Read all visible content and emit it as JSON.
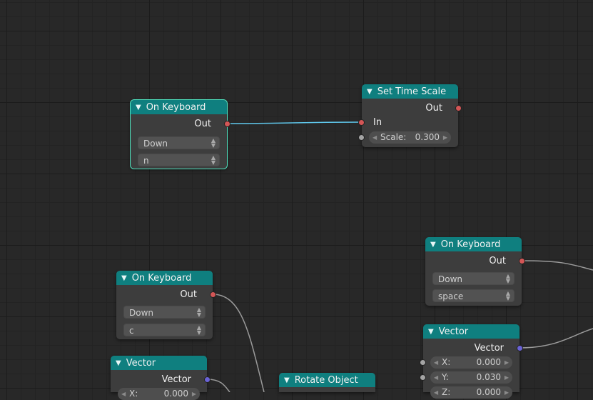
{
  "nodes": {
    "kb1": {
      "title": "On Keyboard",
      "output": "Out",
      "event": "Down",
      "key": "n"
    },
    "timescale": {
      "title": "Set Time Scale",
      "output": "Out",
      "input": "In",
      "scale_label": "Scale:",
      "scale_value": "0.300"
    },
    "kb2": {
      "title": "On Keyboard",
      "output": "Out",
      "event": "Down",
      "key": "space"
    },
    "kb3": {
      "title": "On Keyboard",
      "output": "Out",
      "event": "Down",
      "key": "c"
    },
    "vec1": {
      "title": "Vector",
      "output": "Vector",
      "x_label": "X:",
      "x_value": "0.000",
      "y_label": "Y:",
      "y_value": "0.030",
      "z_label": "Z:",
      "z_value": "0.000"
    },
    "vec2": {
      "title": "Vector",
      "output": "Vector",
      "x_label": "X:",
      "x_value": "0.000"
    },
    "rotate": {
      "title": "Rotate Object"
    }
  },
  "colors": {
    "background": "#282828",
    "node_header": "#0f7f7f",
    "selected_outline": "#4fe3bf",
    "link": "#9a9a9a",
    "active_link": "#5fc6ea"
  }
}
